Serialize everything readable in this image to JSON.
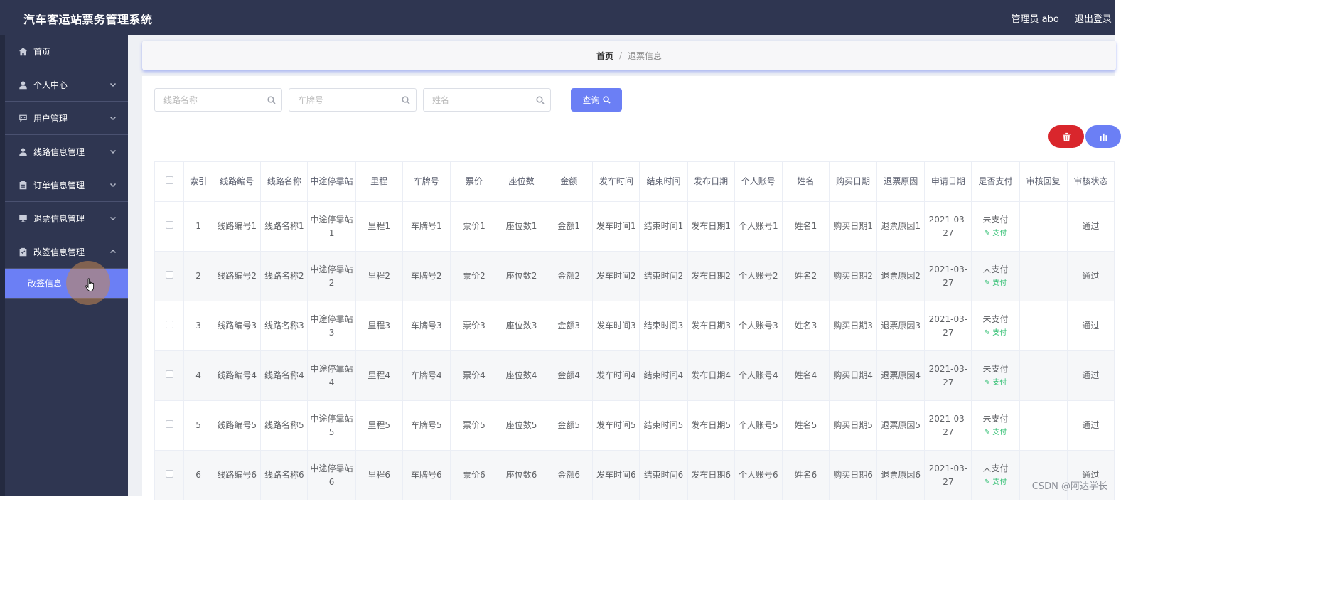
{
  "app": {
    "title": "汽车客运站票务管理系统",
    "user_label": "管理员 abo",
    "logout_label": "退出登录"
  },
  "sidebar": {
    "items": [
      {
        "label": "首页",
        "icon": "home-icon",
        "chevron": false
      },
      {
        "label": "个人中心",
        "icon": "user-icon",
        "chevron": "down"
      },
      {
        "label": "用户管理",
        "icon": "chat-icon",
        "chevron": "down"
      },
      {
        "label": "线路信息管理",
        "icon": "user-icon",
        "chevron": "down"
      },
      {
        "label": "订单信息管理",
        "icon": "clipboard-icon",
        "chevron": "down"
      },
      {
        "label": "退票信息管理",
        "icon": "monitor-icon",
        "chevron": "down"
      },
      {
        "label": "改签信息管理",
        "icon": "clipboard-icon",
        "chevron": "up"
      }
    ],
    "sub_item": "改签信息"
  },
  "breadcrumb": {
    "home": "首页",
    "separator": "/",
    "current": "退票信息"
  },
  "search": {
    "route_name_placeholder": "线路名称",
    "plate_placeholder": "车牌号",
    "name_placeholder": "姓名",
    "query_label": "查询"
  },
  "actions": {
    "delete_icon": "trash-icon",
    "stats_icon": "bar-chart-icon"
  },
  "table": {
    "headers": [
      "索引",
      "线路编号",
      "线路名称",
      "中途停靠站",
      "里程",
      "车牌号",
      "票价",
      "座位数",
      "金额",
      "发车时间",
      "结束时间",
      "发布日期",
      "个人账号",
      "姓名",
      "购买日期",
      "退票原因",
      "申请日期",
      "是否支付",
      "审核回复",
      "审核状态"
    ],
    "pay_action": "支付",
    "rows": [
      {
        "index": "1",
        "route_no": "线路编号1",
        "route_name": "线路名称1",
        "stop": "中途停靠站1",
        "mileage": "里程1",
        "plate": "车牌号1",
        "price": "票价1",
        "seats": "座位数1",
        "amount": "金额1",
        "depart": "发车时间1",
        "end": "结束时间1",
        "publish": "发布日期1",
        "account": "个人账号1",
        "name": "姓名1",
        "buy_date": "购买日期1",
        "reason": "退票原因1",
        "apply_date": "2021-03-27",
        "paid": "未支付",
        "reply": "",
        "status": "通过"
      },
      {
        "index": "2",
        "route_no": "线路编号2",
        "route_name": "线路名称2",
        "stop": "中途停靠站2",
        "mileage": "里程2",
        "plate": "车牌号2",
        "price": "票价2",
        "seats": "座位数2",
        "amount": "金额2",
        "depart": "发车时间2",
        "end": "结束时间2",
        "publish": "发布日期2",
        "account": "个人账号2",
        "name": "姓名2",
        "buy_date": "购买日期2",
        "reason": "退票原因2",
        "apply_date": "2021-03-27",
        "paid": "未支付",
        "reply": "",
        "status": "通过"
      },
      {
        "index": "3",
        "route_no": "线路编号3",
        "route_name": "线路名称3",
        "stop": "中途停靠站3",
        "mileage": "里程3",
        "plate": "车牌号3",
        "price": "票价3",
        "seats": "座位数3",
        "amount": "金额3",
        "depart": "发车时间3",
        "end": "结束时间3",
        "publish": "发布日期3",
        "account": "个人账号3",
        "name": "姓名3",
        "buy_date": "购买日期3",
        "reason": "退票原因3",
        "apply_date": "2021-03-27",
        "paid": "未支付",
        "reply": "",
        "status": "通过"
      },
      {
        "index": "4",
        "route_no": "线路编号4",
        "route_name": "线路名称4",
        "stop": "中途停靠站4",
        "mileage": "里程4",
        "plate": "车牌号4",
        "price": "票价4",
        "seats": "座位数4",
        "amount": "金额4",
        "depart": "发车时间4",
        "end": "结束时间4",
        "publish": "发布日期4",
        "account": "个人账号4",
        "name": "姓名4",
        "buy_date": "购买日期4",
        "reason": "退票原因4",
        "apply_date": "2021-03-27",
        "paid": "未支付",
        "reply": "",
        "status": "通过"
      },
      {
        "index": "5",
        "route_no": "线路编号5",
        "route_name": "线路名称5",
        "stop": "中途停靠站5",
        "mileage": "里程5",
        "plate": "车牌号5",
        "price": "票价5",
        "seats": "座位数5",
        "amount": "金额5",
        "depart": "发车时间5",
        "end": "结束时间5",
        "publish": "发布日期5",
        "account": "个人账号5",
        "name": "姓名5",
        "buy_date": "购买日期5",
        "reason": "退票原因5",
        "apply_date": "2021-03-27",
        "paid": "未支付",
        "reply": "",
        "status": "通过"
      },
      {
        "index": "6",
        "route_no": "线路编号6",
        "route_name": "线路名称6",
        "stop": "中途停靠站6",
        "mileage": "里程6",
        "plate": "车牌号6",
        "price": "票价6",
        "seats": "座位数6",
        "amount": "金额6",
        "depart": "发车时间6",
        "end": "结束时间6",
        "publish": "发布日期6",
        "account": "个人账号6",
        "name": "姓名6",
        "buy_date": "购买日期6",
        "reason": "退票原因6",
        "apply_date": "2021-03-27",
        "paid": "未支付",
        "reply": "",
        "status": "通过"
      }
    ]
  },
  "watermark": "CSDN @阿达学长",
  "colors": {
    "header_bg": "#2f3651",
    "accent": "#6b7ff5",
    "danger": "#d9262c",
    "pay_link": "#2fbf71"
  }
}
